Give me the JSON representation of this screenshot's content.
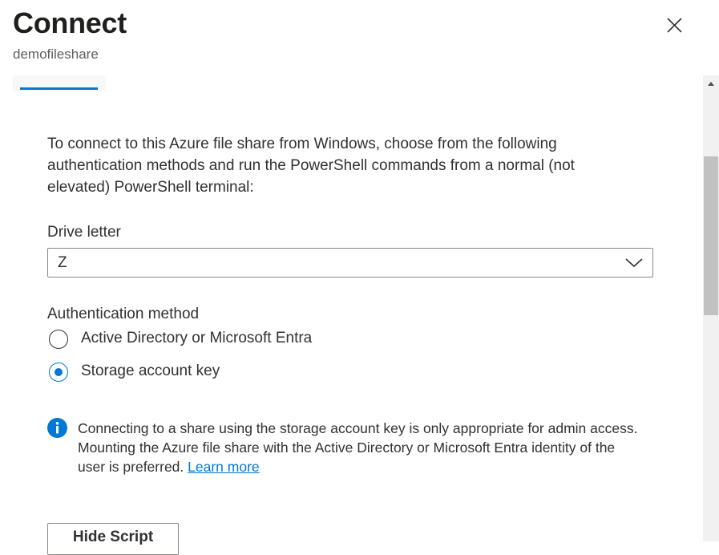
{
  "header": {
    "title": "Connect",
    "subtitle": "demofileshare",
    "close_icon": "close-icon"
  },
  "intro": "To connect to this Azure file share from Windows, choose from the following authentication methods and run the PowerShell commands from a normal (not elevated) PowerShell terminal:",
  "drive": {
    "label": "Drive letter",
    "value": "Z",
    "icon": "chevron-down-icon"
  },
  "auth": {
    "label": "Authentication method",
    "options": [
      {
        "label": "Active Directory or Microsoft Entra",
        "checked": false
      },
      {
        "label": "Storage account key",
        "checked": true
      }
    ]
  },
  "info": {
    "icon": "info-icon",
    "text": "Connecting to a share using the storage account key is only appropriate for admin access. Mounting the Azure file share with the Active Directory or Microsoft Entra identity of the user is preferred.",
    "link": "Learn more"
  },
  "buttons": {
    "hide_script": "Hide Script"
  },
  "colors": {
    "accent": "#0078d4",
    "text": "#323130",
    "border": "#8a8886"
  }
}
